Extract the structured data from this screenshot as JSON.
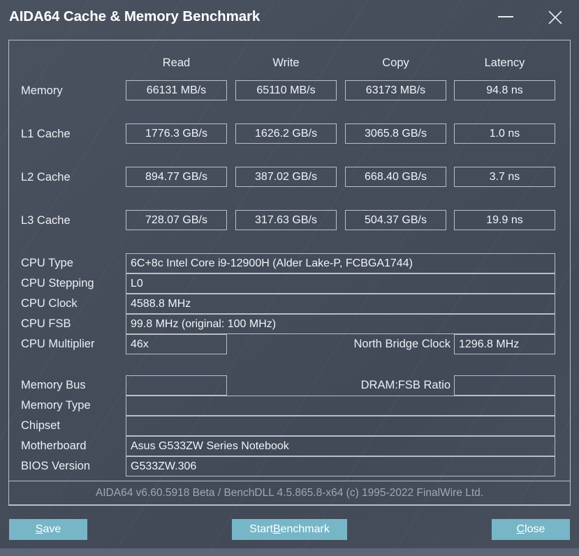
{
  "window": {
    "title": "AIDA64 Cache & Memory Benchmark",
    "minimize_icon": "minimize-icon",
    "close_icon": "close-icon"
  },
  "benchmark_table": {
    "columns": [
      "Read",
      "Write",
      "Copy",
      "Latency"
    ],
    "rows": [
      {
        "label": "Memory",
        "read": "66131 MB/s",
        "write": "65110 MB/s",
        "copy": "63173 MB/s",
        "latency": "94.8 ns"
      },
      {
        "label": "L1 Cache",
        "read": "1776.3 GB/s",
        "write": "1626.2 GB/s",
        "copy": "3065.8 GB/s",
        "latency": "1.0 ns"
      },
      {
        "label": "L2 Cache",
        "read": "894.77 GB/s",
        "write": "387.02 GB/s",
        "copy": "668.40 GB/s",
        "latency": "3.7 ns"
      },
      {
        "label": "L3 Cache",
        "read": "728.07 GB/s",
        "write": "317.63 GB/s",
        "copy": "504.37 GB/s",
        "latency": "19.9 ns"
      }
    ]
  },
  "system_info": {
    "cpu_type_label": "CPU Type",
    "cpu_type_value": "6C+8c Intel Core i9-12900H  (Alder Lake-P, FCBGA1744)",
    "cpu_stepping_label": "CPU Stepping",
    "cpu_stepping_value": "L0",
    "cpu_clock_label": "CPU Clock",
    "cpu_clock_value": "4588.8 MHz",
    "cpu_fsb_label": "CPU FSB",
    "cpu_fsb_value": "99.8 MHz  (original: 100 MHz)",
    "cpu_multiplier_label": "CPU Multiplier",
    "cpu_multiplier_value": "46x",
    "north_bridge_clock_label": "North Bridge Clock",
    "north_bridge_clock_value": "1296.8 MHz",
    "memory_bus_label": "Memory Bus",
    "memory_bus_value": "",
    "dram_fsb_ratio_label": "DRAM:FSB Ratio",
    "dram_fsb_ratio_value": "",
    "memory_type_label": "Memory Type",
    "memory_type_value": "",
    "chipset_label": "Chipset",
    "chipset_value": "",
    "motherboard_label": "Motherboard",
    "motherboard_value": "Asus G533ZW Series Notebook",
    "bios_version_label": "BIOS Version",
    "bios_version_value": "G533ZW.306"
  },
  "footer": {
    "version_text": "AIDA64 v6.60.5918 Beta / BenchDLL 4.5.865.8-x64  (c) 1995-2022 FinalWire Ltd."
  },
  "buttons": {
    "save": {
      "prefix": "",
      "accel": "S",
      "suffix": "ave"
    },
    "start_benchmark": {
      "prefix": "Start ",
      "accel": "B",
      "suffix": "enchmark"
    },
    "close": {
      "prefix": "",
      "accel": "C",
      "suffix": "lose"
    }
  },
  "colors": {
    "window_background": "#454d5b",
    "button_accent": "#77b6c6",
    "border": "#b9bfc7",
    "text_primary": "#eceef2",
    "text_muted": "#9ea8b4",
    "bottom_strip": "#5b6676"
  }
}
